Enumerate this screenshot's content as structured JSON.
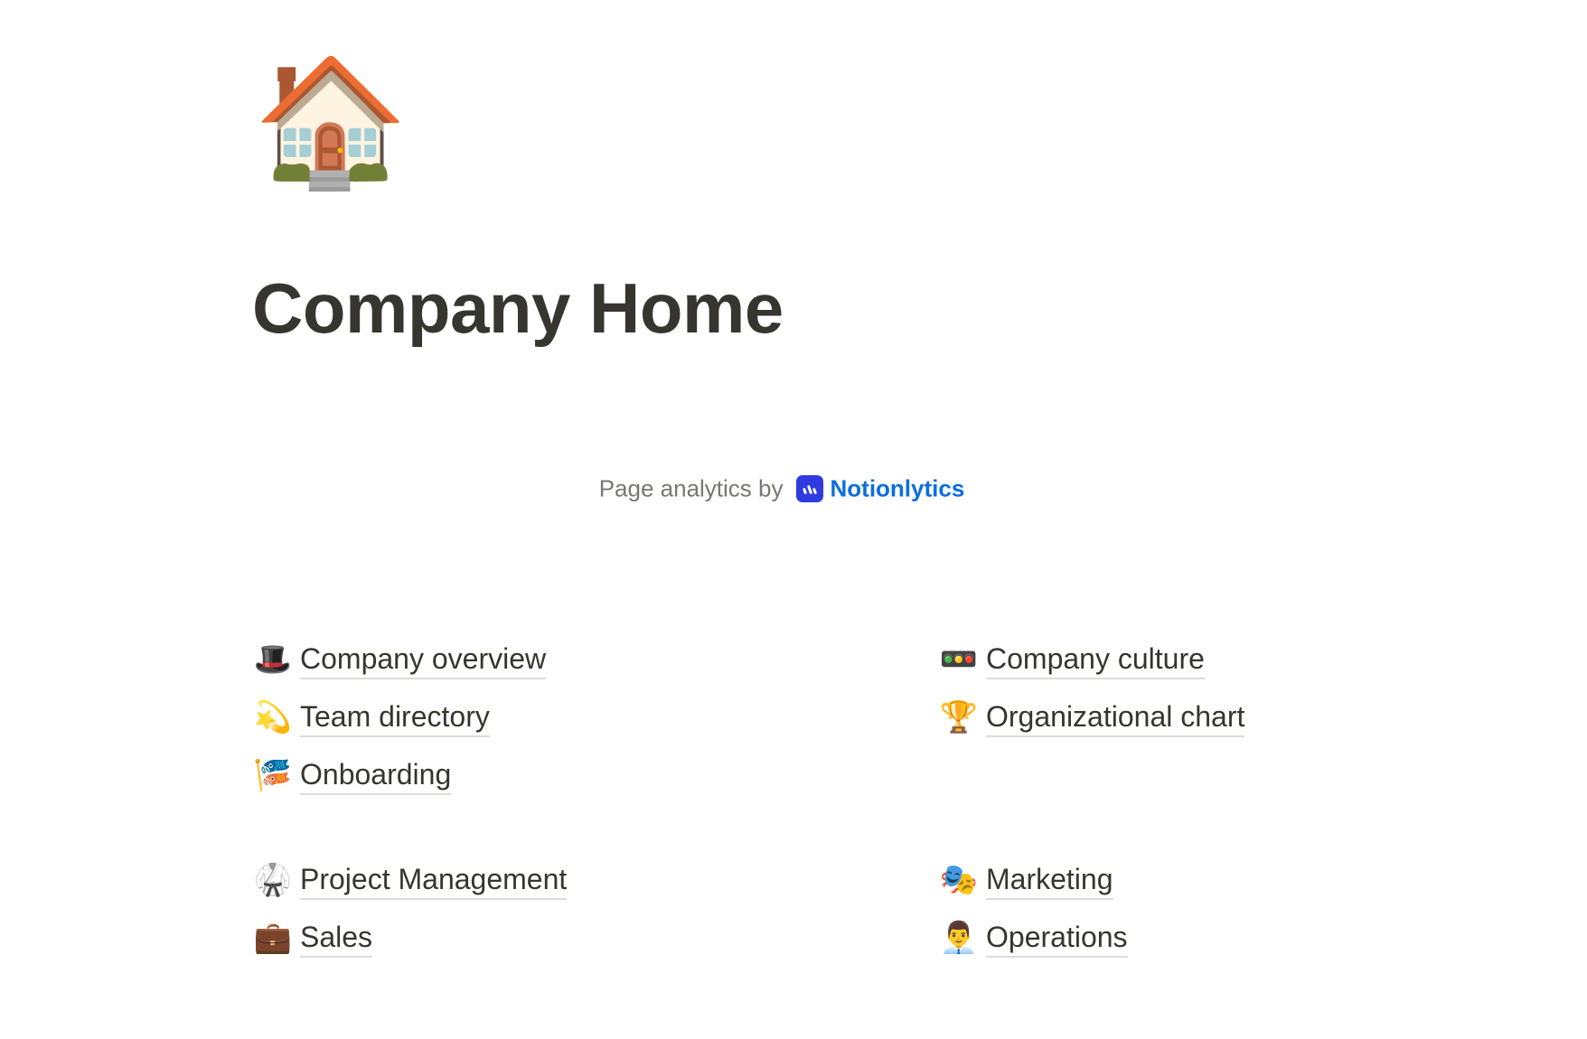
{
  "page": {
    "icon": "🏠",
    "icon_name": "house-icon",
    "title": "Company Home"
  },
  "analytics": {
    "label": "Page analytics by",
    "brand_name": "Notionlytics",
    "brand_color": "#0b6ee0",
    "logo_color": "#2f3ae0"
  },
  "links": {
    "left_group_1": [
      {
        "emoji": "🎩",
        "icon_name": "top-hat-icon",
        "label": "Company overview"
      },
      {
        "emoji": "💫",
        "icon_name": "dizzy-icon",
        "label": "Team directory"
      },
      {
        "emoji": "🎏",
        "icon_name": "carp-streamer-icon",
        "label": "Onboarding"
      }
    ],
    "right_group_1": [
      {
        "emoji": "🚥",
        "icon_name": "traffic-light-icon",
        "label": "Company culture"
      },
      {
        "emoji": "🏆",
        "icon_name": "trophy-icon",
        "label": "Organizational chart"
      }
    ],
    "left_group_2": [
      {
        "emoji": "🥋",
        "icon_name": "martial-arts-uniform-icon",
        "label": "Project Management"
      },
      {
        "emoji": "💼",
        "icon_name": "briefcase-icon",
        "label": "Sales"
      }
    ],
    "right_group_2": [
      {
        "emoji": "🎭",
        "icon_name": "performing-arts-icon",
        "label": "Marketing"
      },
      {
        "emoji": "👨‍💼",
        "icon_name": "office-worker-icon",
        "label": "Operations"
      }
    ]
  }
}
